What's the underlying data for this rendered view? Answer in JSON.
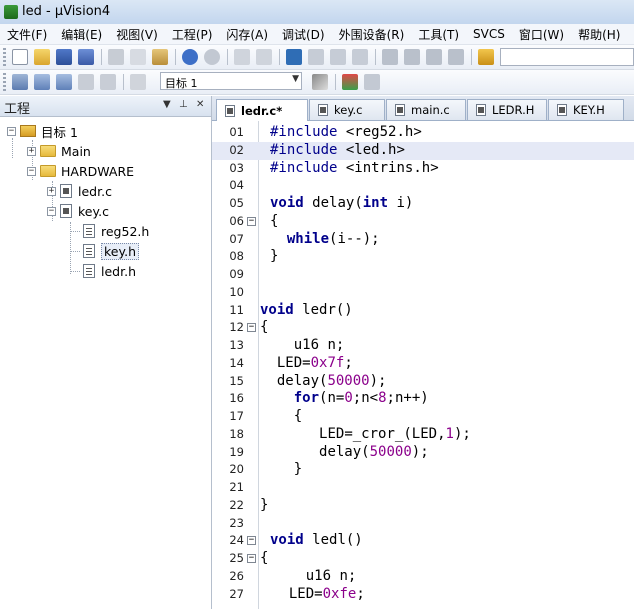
{
  "window": {
    "title": "led  - μVision4"
  },
  "menu": [
    "文件(F)",
    "编辑(E)",
    "视图(V)",
    "工程(P)",
    "闪存(A)",
    "调试(D)",
    "外围设备(R)",
    "工具(T)",
    "SVCS",
    "窗口(W)",
    "帮助(H)"
  ],
  "toolbar2": {
    "target_value": "目标 1"
  },
  "project_pane": {
    "title": "工程",
    "tree": [
      {
        "label": "目标 1",
        "kind": "target"
      },
      {
        "label": "Main",
        "kind": "folder"
      },
      {
        "label": "HARDWARE",
        "kind": "folder"
      },
      {
        "label": "ledr.c",
        "kind": "source"
      },
      {
        "label": "key.c",
        "kind": "source"
      },
      {
        "label": "reg52.h",
        "kind": "header"
      },
      {
        "label": "key.h",
        "kind": "header"
      },
      {
        "label": "ledr.h",
        "kind": "header"
      }
    ]
  },
  "editor": {
    "tabs": [
      "ledr.c*",
      "key.c",
      "main.c",
      "LEDR.H",
      "KEY.H"
    ],
    "active_tab": "ledr.c*",
    "lines": [
      {
        "n": "01",
        "t": "#include <reg52.h>"
      },
      {
        "n": "02",
        "t": "#include <led.h>"
      },
      {
        "n": "03",
        "t": "#include <intrins.h>"
      },
      {
        "n": "04",
        "t": ""
      },
      {
        "n": "05",
        "t": "void delay(int i)"
      },
      {
        "n": "06",
        "t": "{"
      },
      {
        "n": "07",
        "t": "  while(i--);"
      },
      {
        "n": "08",
        "t": "}"
      },
      {
        "n": "09",
        "t": ""
      },
      {
        "n": "10",
        "t": ""
      },
      {
        "n": "11",
        "t": "void ledr()"
      },
      {
        "n": "12",
        "t": "{"
      },
      {
        "n": "13",
        "t": "    u16 n;"
      },
      {
        "n": "14",
        "t": "  LED=0x7f;"
      },
      {
        "n": "15",
        "t": "  delay(50000);"
      },
      {
        "n": "16",
        "t": "    for(n=0;n<8;n++)"
      },
      {
        "n": "17",
        "t": "    {"
      },
      {
        "n": "18",
        "t": "       LED=_cror_(LED,1);"
      },
      {
        "n": "19",
        "t": "       delay(50000);"
      },
      {
        "n": "20",
        "t": "    }"
      },
      {
        "n": "21",
        "t": ""
      },
      {
        "n": "22",
        "t": "}"
      },
      {
        "n": "23",
        "t": ""
      },
      {
        "n": "24",
        "t": "void ledl()"
      },
      {
        "n": "25",
        "t": "{"
      },
      {
        "n": "26",
        "t": "    u16 n;"
      },
      {
        "n": "27",
        "t": "  LED=0xfe;"
      }
    ]
  },
  "colors": {
    "keyword": "#00008b",
    "number": "#8b008b",
    "current_line": "#e5e9f6"
  }
}
